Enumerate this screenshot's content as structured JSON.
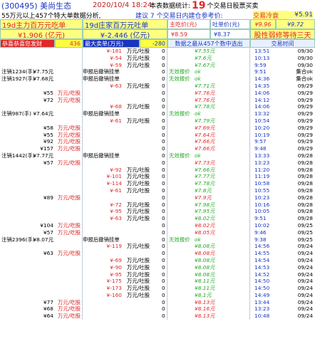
{
  "header": {
    "code": "(300495)",
    "name": "美尚生态",
    "datetime": "2020/10/4 18:24",
    "stat_prefix": "本表数据统计:",
    "stat_days": "19",
    "stat_suffix": "个交易日股票买卖",
    "line2_a": "55万元以上457个特大单数据分析,",
    "line2_b": "建议 7 个交易日内建仓参考价:",
    "line2_c": "交易冷衰",
    "line2_d": "¥5.91"
  },
  "summary": {
    "main_buy_label": "19d主力百万元吃单",
    "main_buy_value": "¥1.906 (亿元)",
    "main_sell_label": "19d庄家百万元吐单",
    "main_sell_value": "¥-2.446 (亿元)",
    "buy_price_label": "主吃价(元)",
    "buy_price_value": "¥8.59",
    "sell_price_label": "吐单价(元)",
    "sell_price_value": "¥8.37",
    "hi1": "¥9.96",
    "hi2": "¥9.72",
    "signal": "股性弱修等待三天"
  },
  "table_head": {
    "buy_title": "恭喜恭喜您发财",
    "buy_count": "436",
    "sell_title": "最大卖单(万元)",
    "sell_count": "-280",
    "mid_title": "数据之最从457个数中选出",
    "time_title": "交易时间"
  },
  "rows": [
    {
      "lbl": "",
      "bv": "",
      "buy": "",
      "sref": "",
      "sv": "¥-181",
      "st": "万元/吐股",
      "z": "0",
      "ind": "",
      "pr": "¥7.55元",
      "pc": "g",
      "t": "13:51",
      "d": "09/30"
    },
    {
      "lbl": "",
      "bv": "",
      "buy": "",
      "sref": "",
      "sv": "¥-54",
      "st": "万元/吐股",
      "z": "0",
      "ind": "",
      "pr": "¥7.6元",
      "pc": "g",
      "t": "10:13",
      "d": "09/30"
    },
    {
      "lbl": "",
      "bv": "",
      "buy": "",
      "sref": "",
      "sv": "¥-59",
      "st": "万元/吐股",
      "z": "0",
      "ind": "",
      "pr": "¥7.67元",
      "pc": "g",
      "t": "9:59",
      "d": "09/30"
    },
    {
      "lbl": "注销1234(手)",
      "bv": "¥7.75元",
      "buy": "",
      "sref": "申报后撤销挂单",
      "sv": "",
      "st": "",
      "z": "0",
      "ind": "无效报价",
      "pr": "ok",
      "pc": "g",
      "t": "9:51",
      "d": "集合ok"
    },
    {
      "lbl": "注销1927(手)",
      "bv": "¥7.68元",
      "buy": "",
      "sref": "申报后撤销挂单",
      "sv": "",
      "st": "",
      "z": "0",
      "ind": "无效报价",
      "pr": "ok",
      "pc": "g",
      "t": "14:36",
      "d": "集合ok"
    },
    {
      "lbl": "",
      "bv": "",
      "buy": "",
      "sref": "",
      "sv": "¥-63",
      "st": "万元/吐股",
      "z": "0",
      "ind": "",
      "pr": "¥7.71元",
      "pc": "g",
      "t": "14:35",
      "d": "09/29"
    },
    {
      "lbl": "",
      "bv": "¥55",
      "buy": "万元/吃股",
      "sref": "",
      "sv": "",
      "st": "",
      "z": "0",
      "ind": "",
      "pr": "¥7.76元",
      "pc": "r",
      "t": "14:06",
      "d": "09/29"
    },
    {
      "lbl": "",
      "bv": "¥72",
      "buy": "万元/吃股",
      "sref": "",
      "sv": "",
      "st": "",
      "z": "0",
      "ind": "",
      "pr": "¥7.76元",
      "pc": "r",
      "t": "14:12",
      "d": "09/29"
    },
    {
      "lbl": "",
      "bv": "",
      "buy": "",
      "sref": "",
      "sv": "¥-68",
      "st": "万元/吐股",
      "z": "0",
      "ind": "",
      "pr": "¥7.78元",
      "pc": "g",
      "t": "14:06",
      "d": "09/29"
    },
    {
      "lbl": "注销987(手)",
      "bv": "¥7.64元",
      "buy": "",
      "sref": "申报后撤销挂单",
      "sv": "",
      "st": "",
      "z": "0",
      "ind": "无效报价",
      "pr": "ok",
      "pc": "g",
      "t": "13:32",
      "d": "09/29"
    },
    {
      "lbl": "",
      "bv": "",
      "buy": "",
      "sref": "",
      "sv": "¥-61",
      "st": "万元/吐股",
      "z": "0",
      "ind": "",
      "pr": "¥7.79元",
      "pc": "g",
      "t": "10:54",
      "d": "09/29"
    },
    {
      "lbl": "",
      "bv": "¥58",
      "buy": "万元/吃股",
      "sref": "",
      "sv": "",
      "st": "",
      "z": "0",
      "ind": "",
      "pr": "¥7.69元",
      "pc": "r",
      "t": "10:20",
      "d": "09/29"
    },
    {
      "lbl": "",
      "bv": "¥55",
      "buy": "万元/吃股",
      "sref": "",
      "sv": "",
      "st": "",
      "z": "0",
      "ind": "",
      "pr": "¥7.64元",
      "pc": "r",
      "t": "10:19",
      "d": "09/29"
    },
    {
      "lbl": "",
      "bv": "¥92",
      "buy": "万元/吃股",
      "sref": "",
      "sv": "",
      "st": "",
      "z": "0",
      "ind": "",
      "pr": "¥7.66元",
      "pc": "r",
      "t": "9:57",
      "d": "09/29"
    },
    {
      "lbl": "",
      "bv": "¥157",
      "buy": "万元/吃股",
      "sref": "",
      "sv": "",
      "st": "",
      "z": "0",
      "ind": "",
      "pr": "¥7.66元",
      "pc": "r",
      "t": "9:48",
      "d": "09/29"
    },
    {
      "lbl": "注销1442(手)",
      "bv": "¥7.77元",
      "buy": "",
      "sref": "申报后撤销挂单",
      "sv": "",
      "st": "",
      "z": "0",
      "ind": "无效报价",
      "pr": "ok",
      "pc": "g",
      "t": "13:33",
      "d": "09/28"
    },
    {
      "lbl": "",
      "bv": "¥57",
      "buy": "万元/吃股",
      "sref": "",
      "sv": "",
      "st": "",
      "z": "0",
      "ind": "",
      "pr": "¥7.73元",
      "pc": "r",
      "t": "13:23",
      "d": "09/28"
    },
    {
      "lbl": "",
      "bv": "",
      "buy": "",
      "sref": "",
      "sv": "¥-92",
      "st": "万元/吐股",
      "z": "0",
      "ind": "",
      "pr": "¥7.66元",
      "pc": "g",
      "t": "11:20",
      "d": "09/28"
    },
    {
      "lbl": "",
      "bv": "",
      "buy": "",
      "sref": "",
      "sv": "¥-101",
      "st": "万元/吐股",
      "z": "0",
      "ind": "",
      "pr": "¥7.77元",
      "pc": "g",
      "t": "11:19",
      "d": "09/28"
    },
    {
      "lbl": "",
      "bv": "",
      "buy": "",
      "sref": "",
      "sv": "¥-114",
      "st": "万元/吐股",
      "z": "0",
      "ind": "",
      "pr": "¥7.78元",
      "pc": "g",
      "t": "10:58",
      "d": "09/28"
    },
    {
      "lbl": "",
      "bv": "",
      "buy": "",
      "sref": "",
      "sv": "¥-61",
      "st": "万元/吐股",
      "z": "0",
      "ind": "",
      "pr": "¥7.8元",
      "pc": "g",
      "t": "10:55",
      "d": "09/28"
    },
    {
      "lbl": "",
      "bv": "¥89",
      "buy": "万元/吃股",
      "sref": "",
      "sv": "",
      "st": "",
      "z": "0",
      "ind": "",
      "pr": "¥7.9元",
      "pc": "r",
      "t": "10:23",
      "d": "09/28"
    },
    {
      "lbl": "",
      "bv": "",
      "buy": "",
      "sref": "",
      "sv": "¥-72",
      "st": "万元/吐股",
      "z": "0",
      "ind": "",
      "pr": "¥7.98元",
      "pc": "g",
      "t": "10:16",
      "d": "09/28"
    },
    {
      "lbl": "",
      "bv": "",
      "buy": "",
      "sref": "",
      "sv": "¥-95",
      "st": "万元/吐股",
      "z": "0",
      "ind": "",
      "pr": "¥7.95元",
      "pc": "g",
      "t": "10:05",
      "d": "09/28"
    },
    {
      "lbl": "",
      "bv": "",
      "buy": "",
      "sref": "",
      "sv": "¥-63",
      "st": "万元/吐股",
      "z": "0",
      "ind": "",
      "pr": "¥8.02元",
      "pc": "g",
      "t": "9:51",
      "d": "09/28"
    },
    {
      "lbl": "",
      "bv": "¥104",
      "buy": "万元/吃股",
      "sref": "",
      "sv": "",
      "st": "",
      "z": "0",
      "ind": "",
      "pr": "¥8.02元",
      "pc": "r",
      "t": "10:02",
      "d": "09/25"
    },
    {
      "lbl": "",
      "bv": "¥57",
      "buy": "万元/吃股",
      "sref": "",
      "sv": "",
      "st": "",
      "z": "0",
      "ind": "",
      "pr": "¥8.05元",
      "pc": "r",
      "t": "9:46",
      "d": "09/25"
    },
    {
      "lbl": "注销2396(手)",
      "bv": "¥8.07元",
      "buy": "",
      "sref": "申报后撤销挂单",
      "sv": "",
      "st": "",
      "z": "0",
      "ind": "无效报价",
      "pr": "ok",
      "pc": "g",
      "t": "9:38",
      "d": "09/25"
    },
    {
      "lbl": "",
      "bv": "",
      "buy": "",
      "sref": "",
      "sv": "¥-119",
      "st": "万元/吐股",
      "z": "0",
      "ind": "",
      "pr": "¥8.08元",
      "pc": "g",
      "t": "14:56",
      "d": "09/24"
    },
    {
      "lbl": "",
      "bv": "¥63",
      "buy": "万元/吃股",
      "sref": "",
      "sv": "",
      "st": "",
      "z": "0",
      "ind": "",
      "pr": "¥8.08元",
      "pc": "r",
      "t": "14:55",
      "d": "09/24"
    },
    {
      "lbl": "",
      "bv": "",
      "buy": "",
      "sref": "",
      "sv": "¥-69",
      "st": "万元/吐股",
      "z": "0",
      "ind": "",
      "pr": "¥8.08元",
      "pc": "g",
      "t": "14:54",
      "d": "09/24"
    },
    {
      "lbl": "",
      "bv": "",
      "buy": "",
      "sref": "",
      "sv": "¥-90",
      "st": "万元/吐股",
      "z": "0",
      "ind": "",
      "pr": "¥8.08元",
      "pc": "g",
      "t": "14:53",
      "d": "09/24"
    },
    {
      "lbl": "",
      "bv": "",
      "buy": "",
      "sref": "",
      "sv": "¥-95",
      "st": "万元/吐股",
      "z": "0",
      "ind": "",
      "pr": "¥8.08元",
      "pc": "g",
      "t": "14:52",
      "d": "09/24"
    },
    {
      "lbl": "",
      "bv": "",
      "buy": "",
      "sref": "",
      "sv": "¥-175",
      "st": "万元/吐股",
      "z": "0",
      "ind": "",
      "pr": "¥8.11元",
      "pc": "g",
      "t": "14:50",
      "d": "09/24"
    },
    {
      "lbl": "",
      "bv": "",
      "buy": "",
      "sref": "",
      "sv": "¥-173",
      "st": "万元/吐股",
      "z": "0",
      "ind": "",
      "pr": "¥8.11元",
      "pc": "g",
      "t": "14:50",
      "d": "09/24"
    },
    {
      "lbl": "",
      "bv": "",
      "buy": "",
      "sref": "",
      "sv": "¥-160",
      "st": "万元/吐股",
      "z": "0",
      "ind": "",
      "pr": "¥8.1元",
      "pc": "g",
      "t": "14:49",
      "d": "09/24"
    },
    {
      "lbl": "",
      "bv": "¥77",
      "buy": "万元/吃股",
      "sref": "",
      "sv": "",
      "st": "",
      "z": "0",
      "ind": "",
      "pr": "¥8.13元",
      "pc": "r",
      "t": "13:44",
      "d": "09/24"
    },
    {
      "lbl": "",
      "bv": "¥68",
      "buy": "万元/吃股",
      "sref": "",
      "sv": "",
      "st": "",
      "z": "0",
      "ind": "",
      "pr": "¥8.16元",
      "pc": "r",
      "t": "13:23",
      "d": "09/24"
    },
    {
      "lbl": "",
      "bv": "¥64",
      "buy": "万元/吃股",
      "sref": "",
      "sv": "",
      "st": "",
      "z": "0",
      "ind": "",
      "pr": "¥8.13元",
      "pc": "r",
      "t": "10:48",
      "d": "09/24"
    }
  ]
}
